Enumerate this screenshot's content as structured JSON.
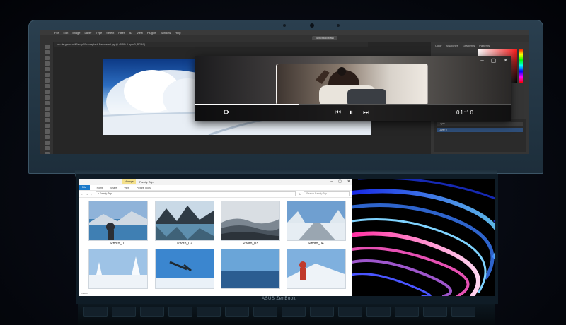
{
  "device": {
    "brand": "ASUS ZenBook"
  },
  "photoshop": {
    "menu": [
      "File",
      "Edit",
      "Image",
      "Layer",
      "Type",
      "Select",
      "Filter",
      "3D",
      "View",
      "Plugins",
      "Window",
      "Help"
    ],
    "share_label": "Select and Mask",
    "doc_tab": "two-de-grand-wMSec4pl01c-unsplash-Recovered.jpg @ 45.5% (Layer 0, RGB/8)",
    "panel_tabs": [
      "Color",
      "Swatches",
      "Gradients",
      "Patterns"
    ],
    "layers": [
      "Layer 0",
      "Layer 1"
    ]
  },
  "player": {
    "time": "01:10",
    "progress": 0.33,
    "icons": [
      "gear-icon",
      "skip-back-icon",
      "pause-icon",
      "skip-forward-icon",
      "minimize-icon",
      "restore-icon",
      "close-icon"
    ]
  },
  "explorer": {
    "manage_tab": "Manage",
    "window_title": "Family Trip",
    "ribbon": [
      "File",
      "Home",
      "Share",
      "View",
      "Picture Tools"
    ],
    "address": "› Family Trip",
    "search_placeholder": "Search Family Trip",
    "status": "8 items",
    "photos": [
      {
        "name": "Photo_01"
      },
      {
        "name": "Photo_02"
      },
      {
        "name": "Photo_03"
      },
      {
        "name": "Photo_04"
      },
      {
        "name": ""
      },
      {
        "name": ""
      },
      {
        "name": ""
      },
      {
        "name": ""
      }
    ]
  }
}
